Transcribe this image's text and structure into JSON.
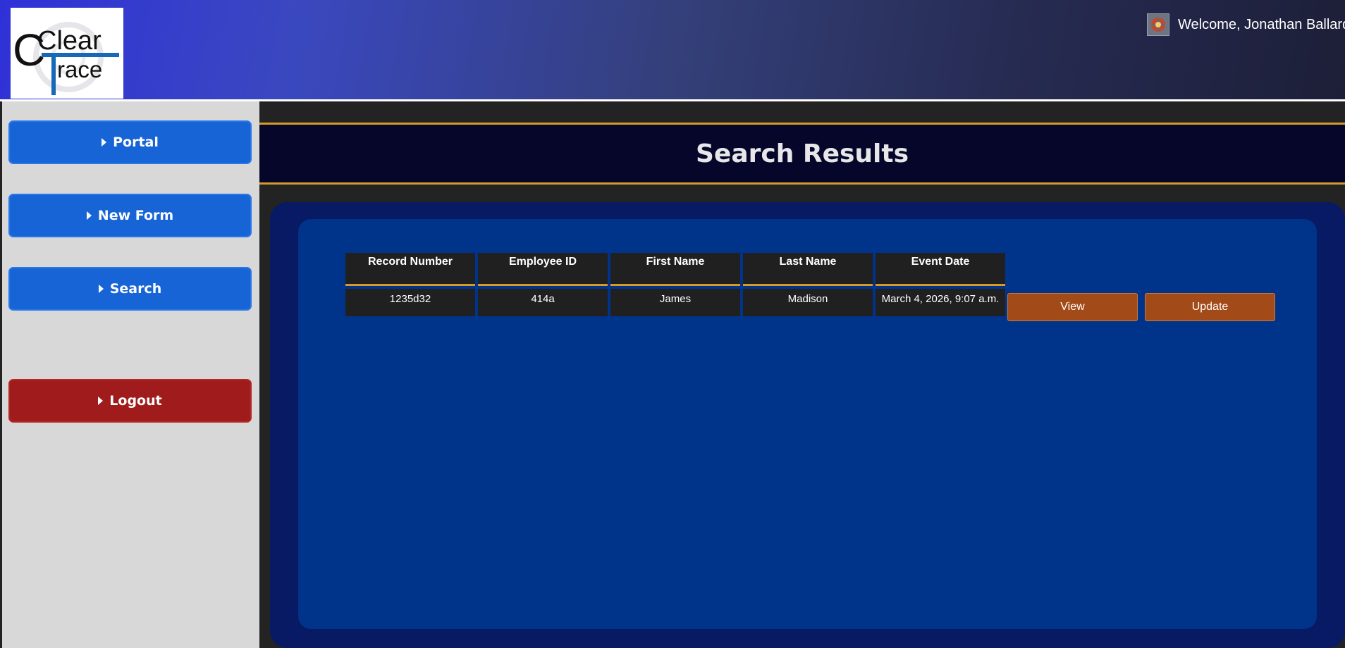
{
  "header": {
    "logo": {
      "line1": "Clear",
      "line2": "race"
    },
    "welcome_text": "Welcome, Jonathan Ballard",
    "avatar_icon": "firefighter-badge-icon"
  },
  "sidebar": {
    "items": [
      {
        "label": "Portal",
        "icon": "caret-right-icon"
      },
      {
        "label": "New Form",
        "icon": "caret-right-icon"
      },
      {
        "label": "Search",
        "icon": "caret-right-icon"
      },
      {
        "label": "Logout",
        "icon": "caret-right-icon"
      }
    ]
  },
  "main": {
    "title": "Search Results",
    "table": {
      "headers": [
        "Record Number",
        "Employee ID",
        "First Name",
        "Last Name",
        "Event Date"
      ],
      "rows": [
        {
          "cells": [
            "1235d32",
            "414a",
            "James",
            "Madison",
            "March 4, 2026, 9:07 a.m."
          ],
          "view_label": "View",
          "update_label": "Update"
        }
      ]
    }
  },
  "colors": {
    "accent_gold": "#d39b2a",
    "button_blue": "#1664d6",
    "button_red": "#a01c1c",
    "action_orange": "#a34b18",
    "panel_blue": "#00348a"
  }
}
